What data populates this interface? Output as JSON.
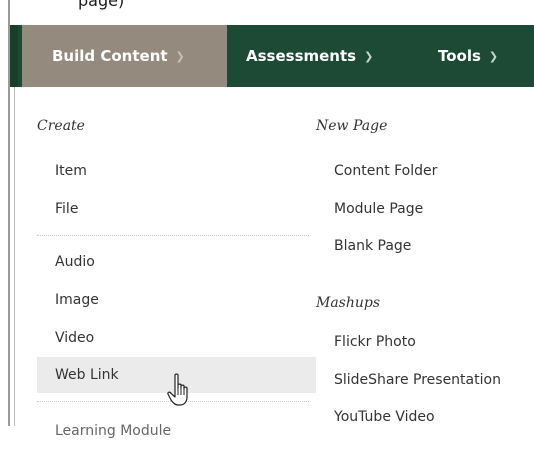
{
  "page": {
    "top_fragment": "page)"
  },
  "menubar": {
    "tabs": [
      {
        "label": "Build Content"
      },
      {
        "label": "Assessments"
      },
      {
        "label": "Tools"
      }
    ]
  },
  "dropdown": {
    "left": {
      "header": "Create",
      "items": [
        {
          "label": "Item"
        },
        {
          "label": "File"
        },
        {
          "label": "Audio"
        },
        {
          "label": "Image"
        },
        {
          "label": "Video"
        },
        {
          "label": "Web Link"
        },
        {
          "label": "Learning Module"
        }
      ]
    },
    "right": {
      "new_page_header": "New Page",
      "new_page_items": [
        {
          "label": "Content Folder"
        },
        {
          "label": "Module Page"
        },
        {
          "label": "Blank Page"
        }
      ],
      "mashups_header": "Mashups",
      "mashups_items": [
        {
          "label": "Flickr Photo"
        },
        {
          "label": "SlideShare Presentation"
        },
        {
          "label": "YouTube Video"
        }
      ]
    }
  },
  "colors": {
    "menubar_bg": "#1c4a34",
    "active_tab_bg": "#958a7e",
    "hover_item_bg": "#ebebeb"
  },
  "icons": {
    "cursor": "hand-pointer-cursor",
    "chevron": "chevron-down-icon"
  }
}
